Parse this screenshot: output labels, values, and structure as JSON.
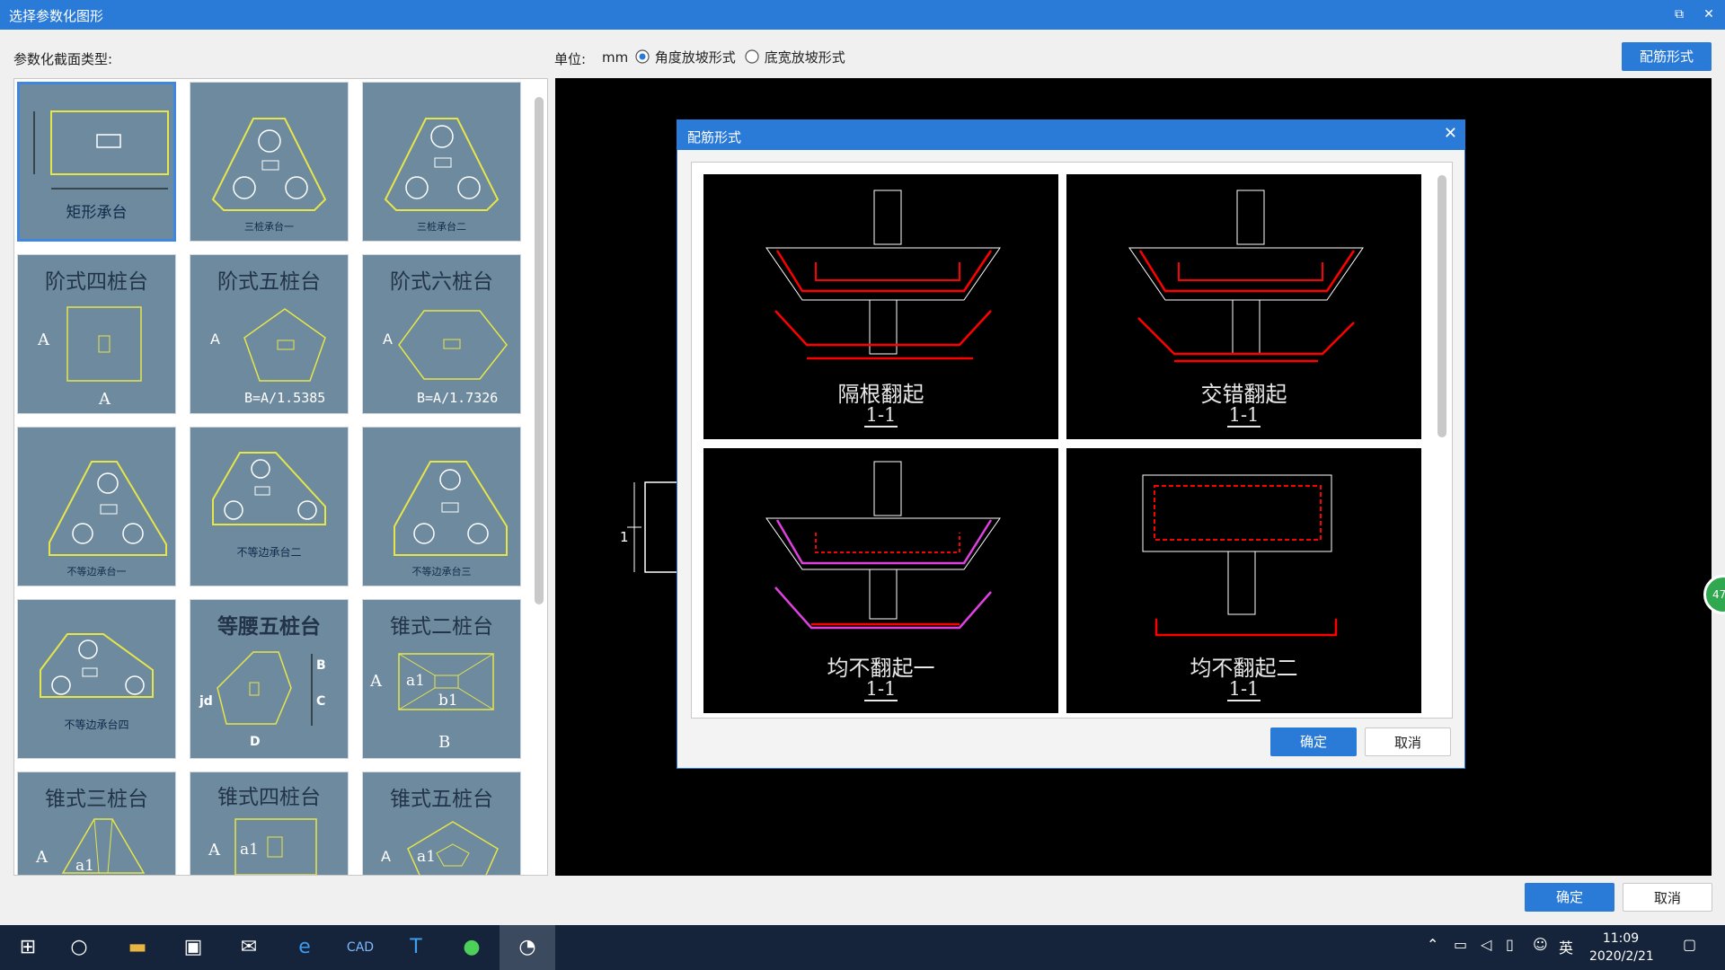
{
  "window": {
    "title": "选择参数化图形"
  },
  "toolbar": {
    "section_label": "参数化截面类型:",
    "unit_label": "单位:",
    "unit_value": "mm",
    "radio_angle": "角度放坡形式",
    "radio_width": "底宽放坡形式",
    "rebar_button": "配筋形式"
  },
  "tiles": [
    {
      "caption": "矩形承台",
      "selected": true
    },
    {
      "caption": "三桩承台一"
    },
    {
      "caption": "三桩承台二"
    },
    {
      "caption": "阶式四桩台",
      "dim1": "A",
      "dim2": "A"
    },
    {
      "caption": "阶式五桩台",
      "dim1": "A",
      "dim2": "B=A/1.5385"
    },
    {
      "caption": "阶式六桩台",
      "dim1": "A",
      "dim2": "B=A/1.7326"
    },
    {
      "caption": "不等边承台一"
    },
    {
      "caption": "不等边承台二"
    },
    {
      "caption": "不等边承台三"
    },
    {
      "caption": "不等边承台四"
    },
    {
      "caption": "等腰五桩台",
      "d1": "B",
      "d2": "C",
      "d3": "D",
      "d4": "jd"
    },
    {
      "caption": "锥式二桩台",
      "d1": "A",
      "d2": "a1",
      "d3": "b1",
      "d4": "B"
    },
    {
      "caption": "锥式三桩台",
      "d1": "A",
      "d2": "a1"
    },
    {
      "caption": "锥式四桩台",
      "d1": "A",
      "d2": "a1"
    },
    {
      "caption": "锥式五桩台",
      "d1": "A",
      "d2": "a1"
    }
  ],
  "dialog": {
    "title": "配筋形式",
    "ok": "确定",
    "cancel": "取消",
    "panels": [
      {
        "title": "隔根翻起",
        "sub": "1-1"
      },
      {
        "title": "交错翻起",
        "sub": "1-1"
      },
      {
        "title": "均不翻起一",
        "sub": "1-1"
      },
      {
        "title": "均不翻起二",
        "sub": "1-1"
      }
    ]
  },
  "canvas_label": "1",
  "footer": {
    "ok": "确定",
    "cancel": "取消"
  },
  "tray": {
    "ime": "英",
    "time": "11:09",
    "date": "2020/2/21",
    "badge": "47"
  }
}
